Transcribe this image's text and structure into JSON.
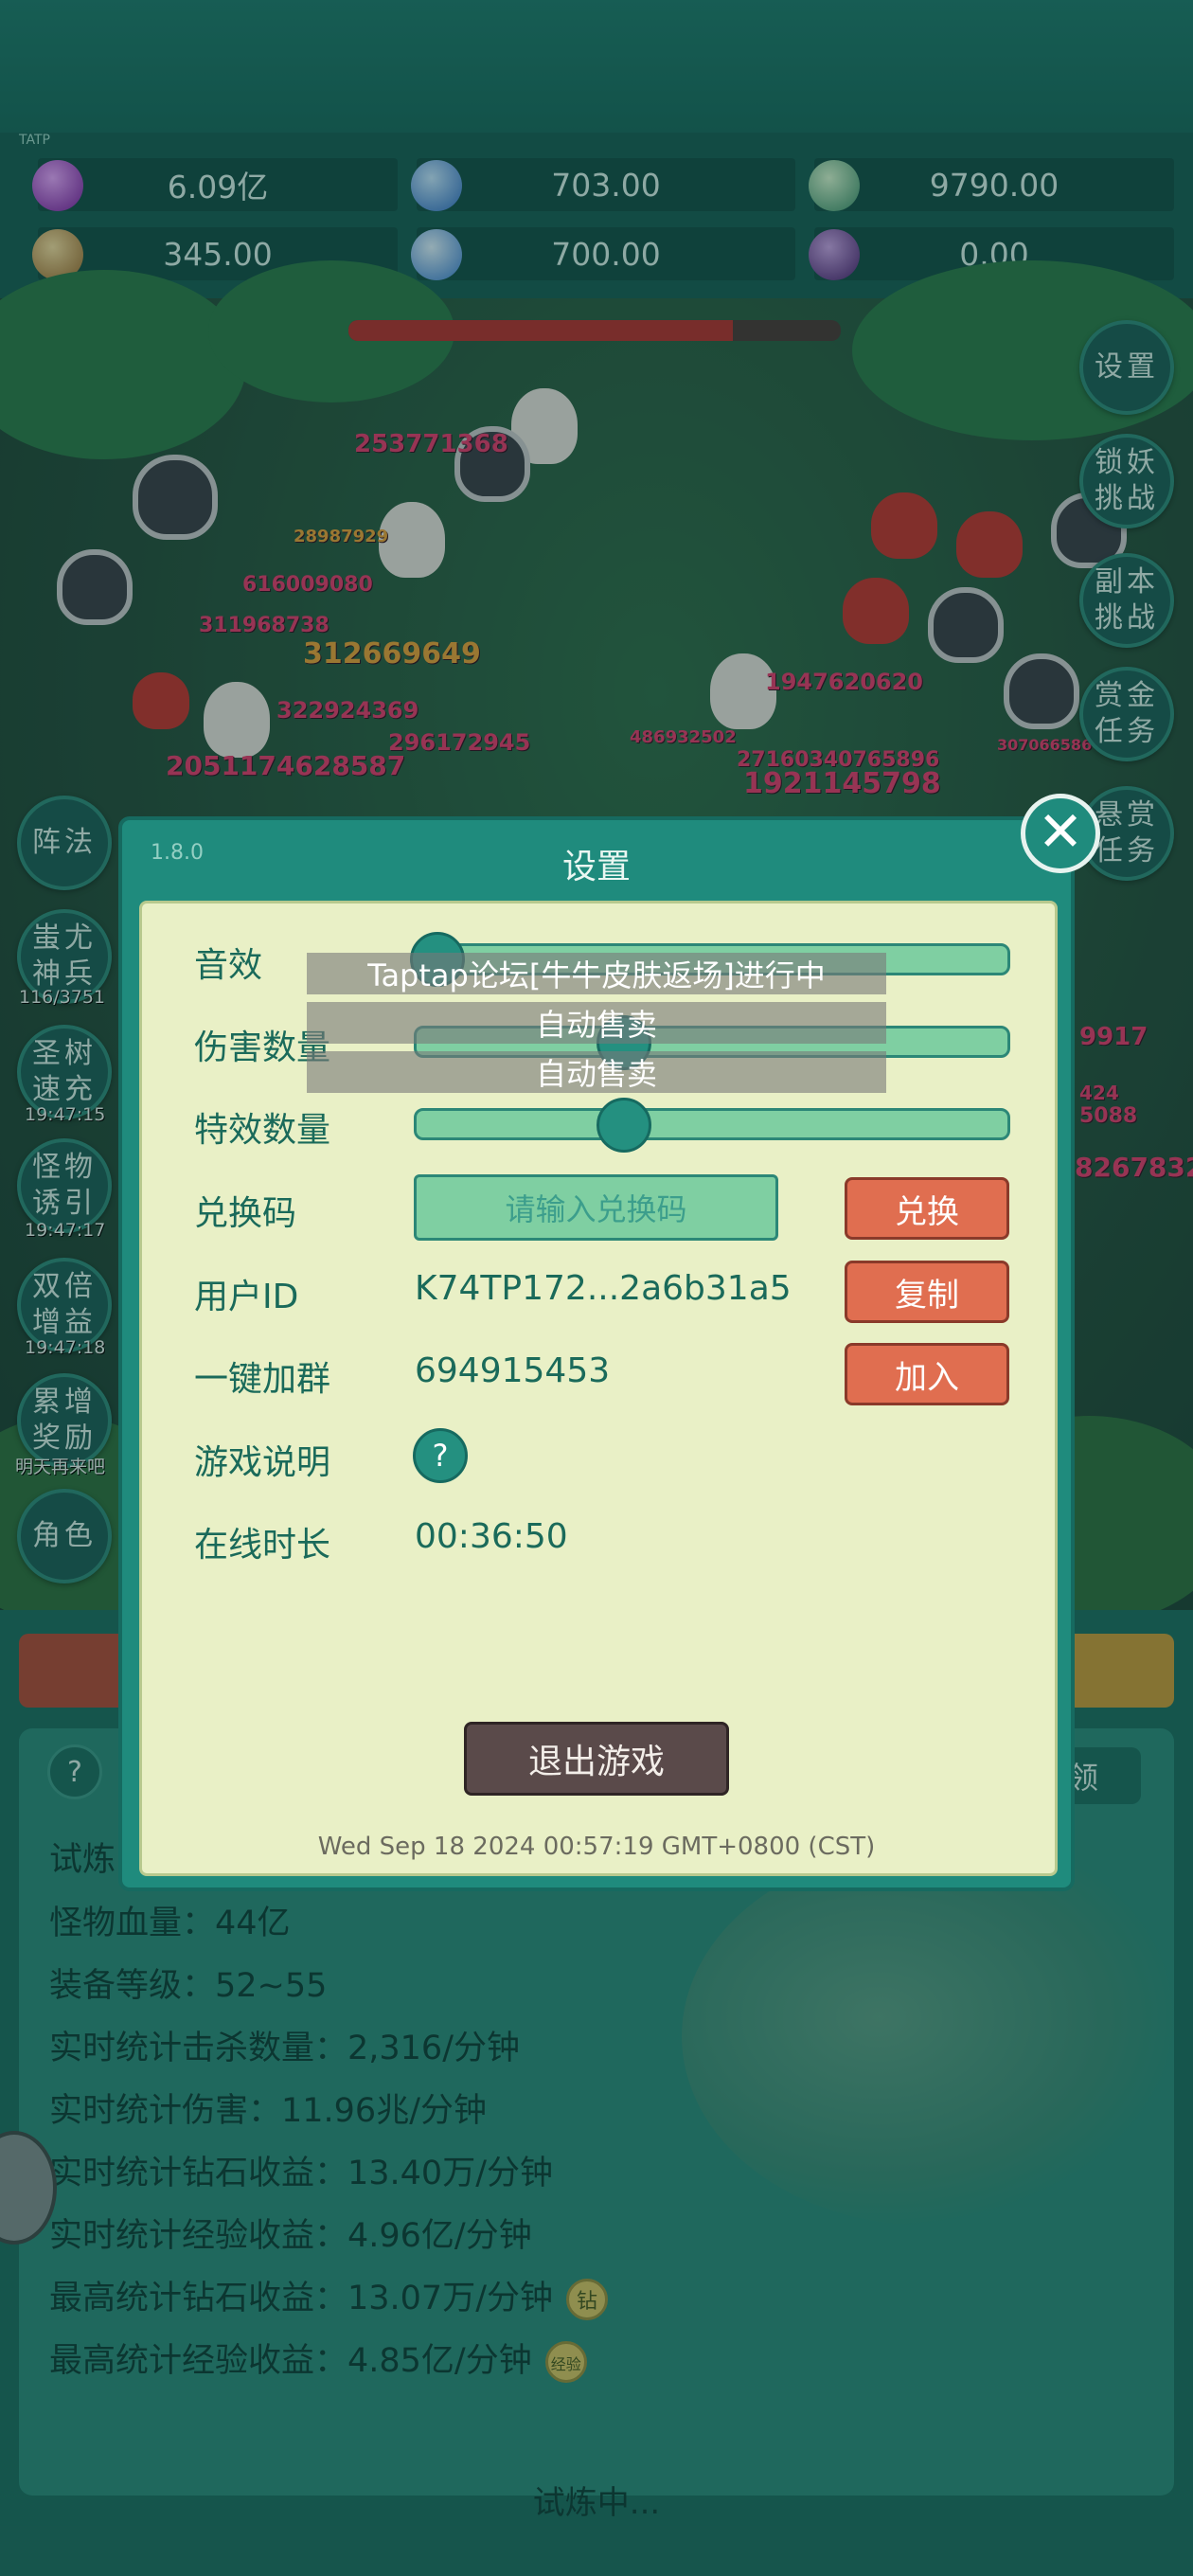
{
  "resources": {
    "tag": "TATP",
    "items": [
      {
        "icon": "purple-gem-icon",
        "value": "6.09亿"
      },
      {
        "icon": "blue-crystal-icon",
        "value": "703.00"
      },
      {
        "icon": "green-orb-icon",
        "value": "9790.00"
      },
      {
        "icon": "scroll-icon",
        "value": "345.00"
      },
      {
        "icon": "blue-shard-icon",
        "value": "700.00"
      },
      {
        "icon": "purple-fruit-icon",
        "value": "0.00"
      }
    ]
  },
  "battle": {
    "damage_numbers": [
      "253771368",
      "28987929",
      "616009080",
      "311968738",
      "312669649",
      "322924369",
      "296172945",
      "2051174628587",
      "1947620620",
      "486932502",
      "1921145798",
      "27160340765896",
      "307066586",
      "9917",
      "424",
      "5088",
      "8267832"
    ],
    "timers": [
      "116/3751",
      "19:47:15",
      "19:47:17",
      "19:47:18",
      "明天再来吧"
    ]
  },
  "side_buttons": {
    "left": [
      "阵法",
      "蚩尤神兵",
      "圣树速充",
      "怪物诱引",
      "双倍增益",
      "累增奖励",
      "角色"
    ],
    "right": [
      "设置",
      "锁妖挑战",
      "副本挑战",
      "赏金任务",
      "悬赏任务"
    ]
  },
  "lower_panel": {
    "claim_label": "领",
    "stats": [
      "试炼",
      "怪物血量：44亿",
      "装备等级：52~55",
      "实时统计击杀数量：2,316/分钟",
      "实时统计伤害：11.96兆/分钟",
      "实时统计钻石收益：13.40万/分钟",
      "实时统计经验收益：4.96亿/分钟",
      "最高统计钻石收益：13.07万/分钟",
      "最高统计经验收益：4.85亿/分钟"
    ],
    "diamond_badge": "钻",
    "exp_badge": "经验",
    "status": "试炼中..."
  },
  "settings": {
    "version": "1.8.0",
    "title": "设置",
    "sound_label": "音效",
    "damage_count_label": "伤害数量",
    "effect_count_label": "特效数量",
    "redeem_label": "兑换码",
    "redeem_placeholder": "请输入兑换码",
    "redeem_button": "兑换",
    "user_id_label": "用户ID",
    "user_id_value": "K74TP172...2a6b31a5",
    "copy_button": "复制",
    "join_group_label": "一键加群",
    "group_number": "694915453",
    "join_button": "加入",
    "guide_label": "游戏说明",
    "online_label": "在线时长",
    "online_value": "00:36:50",
    "exit_button": "退出游戏",
    "timestamp": "Wed Sep 18 2024 00:57:19 GMT+0800 (CST)",
    "sound_level": 0.0,
    "damage_count_level": 0.34,
    "effect_count_level": 0.34
  },
  "toasts": [
    "Taptap论坛[牛牛皮肤返场]进行中",
    "自动售卖",
    "自动售卖"
  ],
  "colors": {
    "accent": "#1f8b7d",
    "panel": "#e9f0c6",
    "button": "#e06e50"
  }
}
